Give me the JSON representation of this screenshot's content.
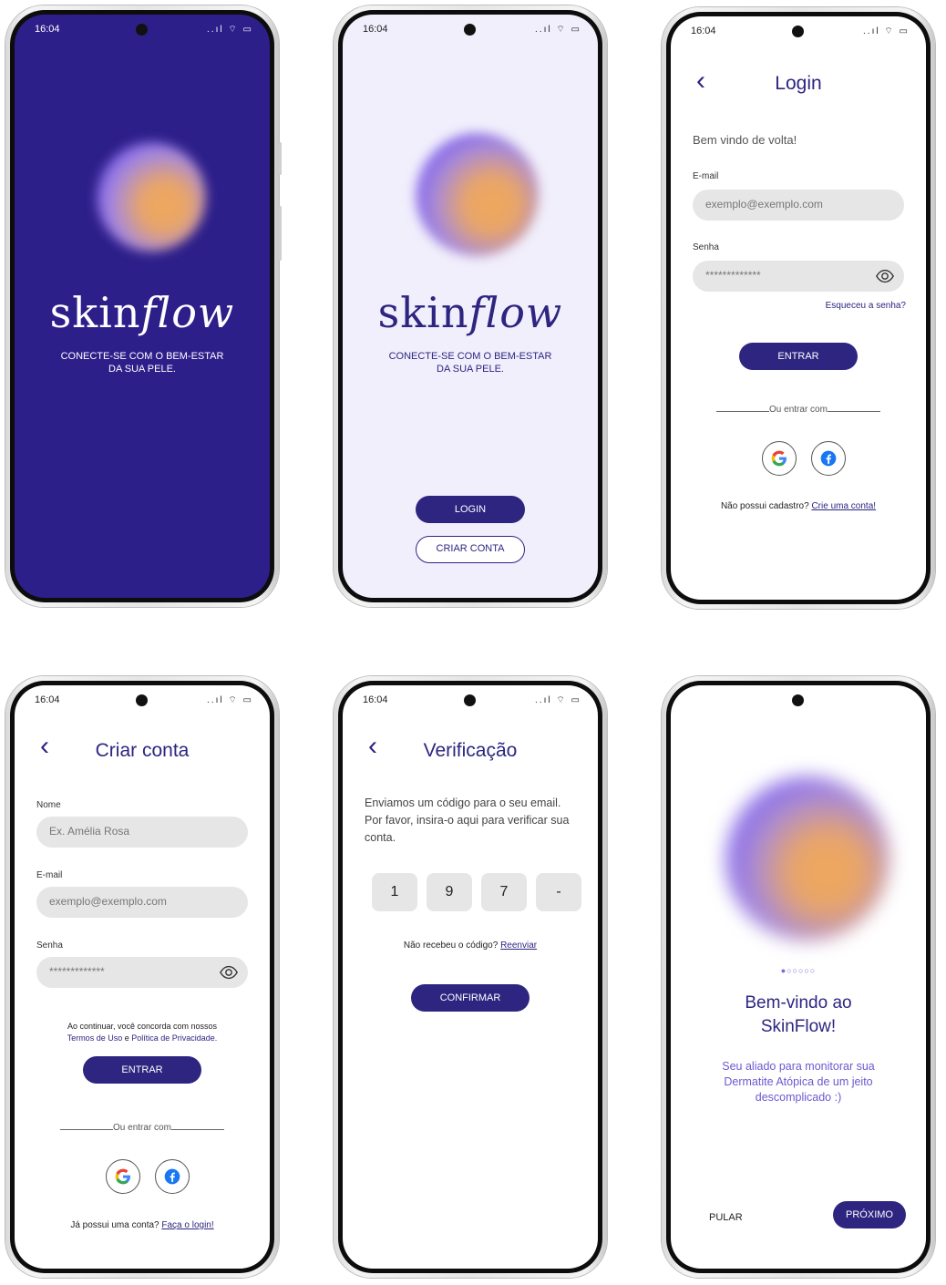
{
  "status": {
    "time": "16:04",
    "icons": "..ıl ⌔ ▭"
  },
  "splash": {
    "brand_a": "skin",
    "brand_b": "flow",
    "tagline_1": "CONECTE-SE COM O BEM-ESTAR",
    "tagline_2": "DA SUA PELE."
  },
  "welcome": {
    "brand_a": "skin",
    "brand_b": "flow",
    "tagline_1": "CONECTE-SE COM O BEM-ESTAR",
    "tagline_2": "DA SUA PELE.",
    "login_label": "LOGIN",
    "create_label": "CRIAR CONTA"
  },
  "login": {
    "back": "‹",
    "title": "Login",
    "greeting": "Bem vindo de volta!",
    "email_label": "E-mail",
    "email_placeholder": "exemplo@exemplo.com",
    "password_label": "Senha",
    "password_value": "*************",
    "forgot": "Esqueceu a senha?",
    "submit": "ENTRAR",
    "alt_login": "Ou entrar com",
    "signup_prompt": "Não possui cadastro?",
    "signup_link": "Crie uma conta!"
  },
  "signup": {
    "back": "‹",
    "title": "Criar conta",
    "name_label": "Nome",
    "name_placeholder": "Ex. Amélia Rosa",
    "email_label": "E-mail",
    "email_placeholder": "exemplo@exemplo.com",
    "password_label": "Senha",
    "password_value": "*************",
    "terms_1": "Ao continuar, você concorda com nossos",
    "terms_link_a": "Termos de Uso",
    "terms_and": " e ",
    "terms_link_b": "Política de Privacidade.",
    "submit": "ENTRAR",
    "alt_login": "Ou entrar com",
    "login_prompt": "Já possui uma conta?",
    "login_link": "Faça o login!"
  },
  "verify": {
    "back": "‹",
    "title": "Verificação",
    "message": "Enviamos um código para o seu email. Por favor, insira-o aqui para verificar sua conta.",
    "digits": [
      "1",
      "9",
      "7",
      "-"
    ],
    "resend_prompt": "Não recebeu o código?",
    "resend_link": "Reenviar",
    "submit": "CONFIRMAR"
  },
  "onboarding": {
    "dots": "●○○○○○",
    "heading_1": "Bem-vindo ao",
    "heading_2": "SkinFlow!",
    "body": "Seu aliado para monitorar sua Dermatite Atópica de um jeito descomplicado :)",
    "skip": "PULAR",
    "next": "PRÓXIMO"
  },
  "colors": {
    "primary": "#2d2580",
    "splash_bg": "#2d1f8a",
    "welcome_bg": "#f1effc"
  }
}
